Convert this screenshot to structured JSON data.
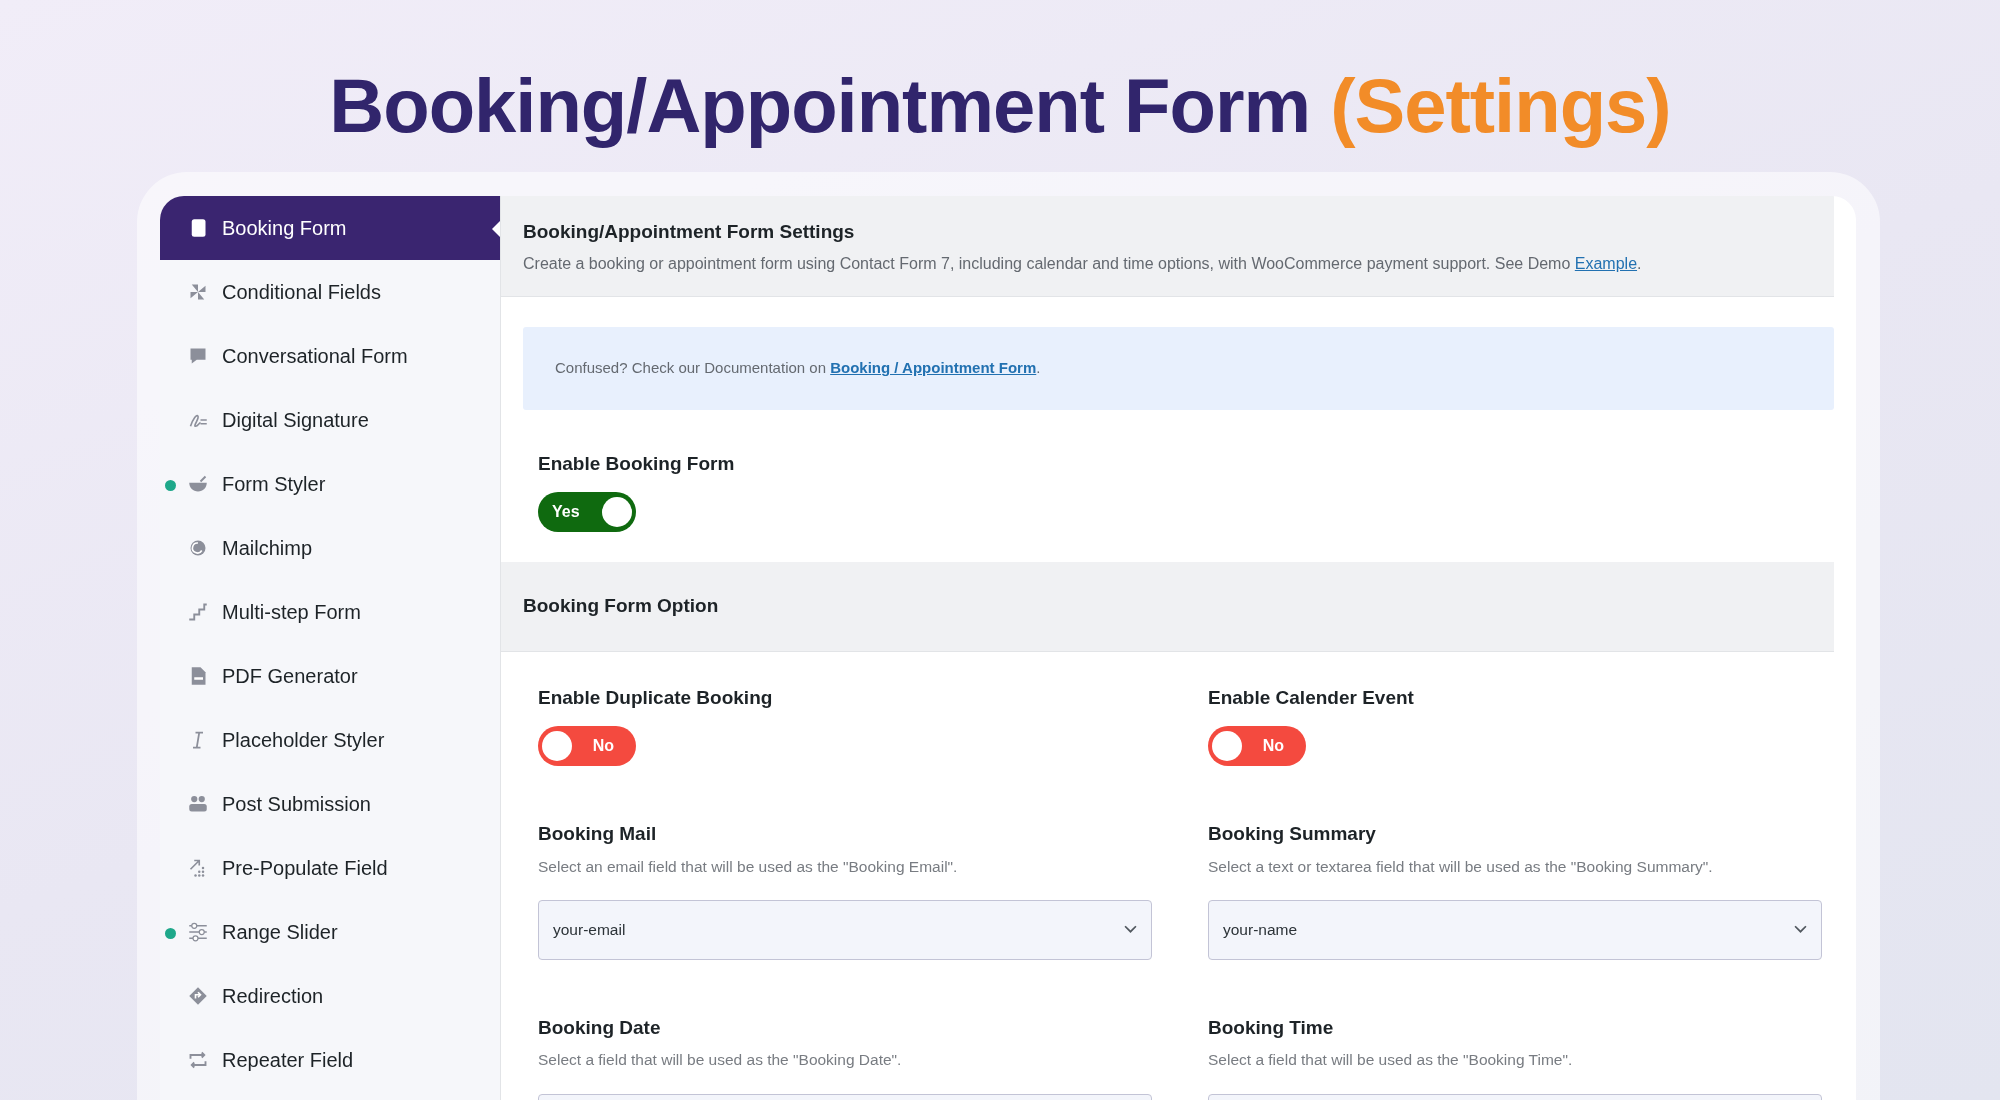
{
  "headline": {
    "text": "Booking/Appointment Form",
    "accent": "(Settings)"
  },
  "sidebar": {
    "items": [
      {
        "label": "Booking Form",
        "selected": true,
        "dot": false
      },
      {
        "label": "Conditional Fields",
        "selected": false,
        "dot": false
      },
      {
        "label": "Conversational Form",
        "selected": false,
        "dot": false
      },
      {
        "label": "Digital Signature",
        "selected": false,
        "dot": false
      },
      {
        "label": "Form Styler",
        "selected": false,
        "dot": true
      },
      {
        "label": "Mailchimp",
        "selected": false,
        "dot": false
      },
      {
        "label": "Multi-step Form",
        "selected": false,
        "dot": false
      },
      {
        "label": "PDF Generator",
        "selected": false,
        "dot": false
      },
      {
        "label": "Placeholder Styler",
        "selected": false,
        "dot": false
      },
      {
        "label": "Post Submission",
        "selected": false,
        "dot": false
      },
      {
        "label": "Pre-Populate Field",
        "selected": false,
        "dot": false
      },
      {
        "label": "Range Slider",
        "selected": false,
        "dot": true
      },
      {
        "label": "Redirection",
        "selected": false,
        "dot": false
      },
      {
        "label": "Repeater Field",
        "selected": false,
        "dot": false
      }
    ]
  },
  "header": {
    "title": "Booking/Appointment Form Settings",
    "description": "Create a booking or appointment form using Contact Form 7, including calendar and time options, with WooCommerce payment support. See Demo ",
    "link": "Example",
    "end": "."
  },
  "notice": {
    "text": "Confused? Check our Documentation on ",
    "link": "Booking / Appointment Form",
    "end": "."
  },
  "enable": {
    "label": "Enable Booking Form",
    "toggle": {
      "on": true,
      "text": "Yes"
    }
  },
  "section": {
    "title": "Booking Form Option",
    "fields": [
      {
        "kind": "toggle",
        "label": "Enable Duplicate Booking",
        "toggle": {
          "on": false,
          "text": "No"
        }
      },
      {
        "kind": "toggle",
        "label": "Enable Calender Event",
        "toggle": {
          "on": false,
          "text": "No"
        }
      },
      {
        "kind": "select",
        "label": "Booking Mail",
        "description": "Select an email field that will be used as the \"Booking Email\".",
        "value": "your-email"
      },
      {
        "kind": "select",
        "label": "Booking Summary",
        "description": "Select a text or textarea field that will be used as the \"Booking Summary\".",
        "value": "your-name"
      },
      {
        "kind": "select",
        "label": "Booking Date",
        "description": "Select a field that will be used as the \"Booking Date\"."
      },
      {
        "kind": "select",
        "label": "Booking Time",
        "description": "Select a field that will be used as the \"Booking Time\"."
      }
    ]
  }
}
